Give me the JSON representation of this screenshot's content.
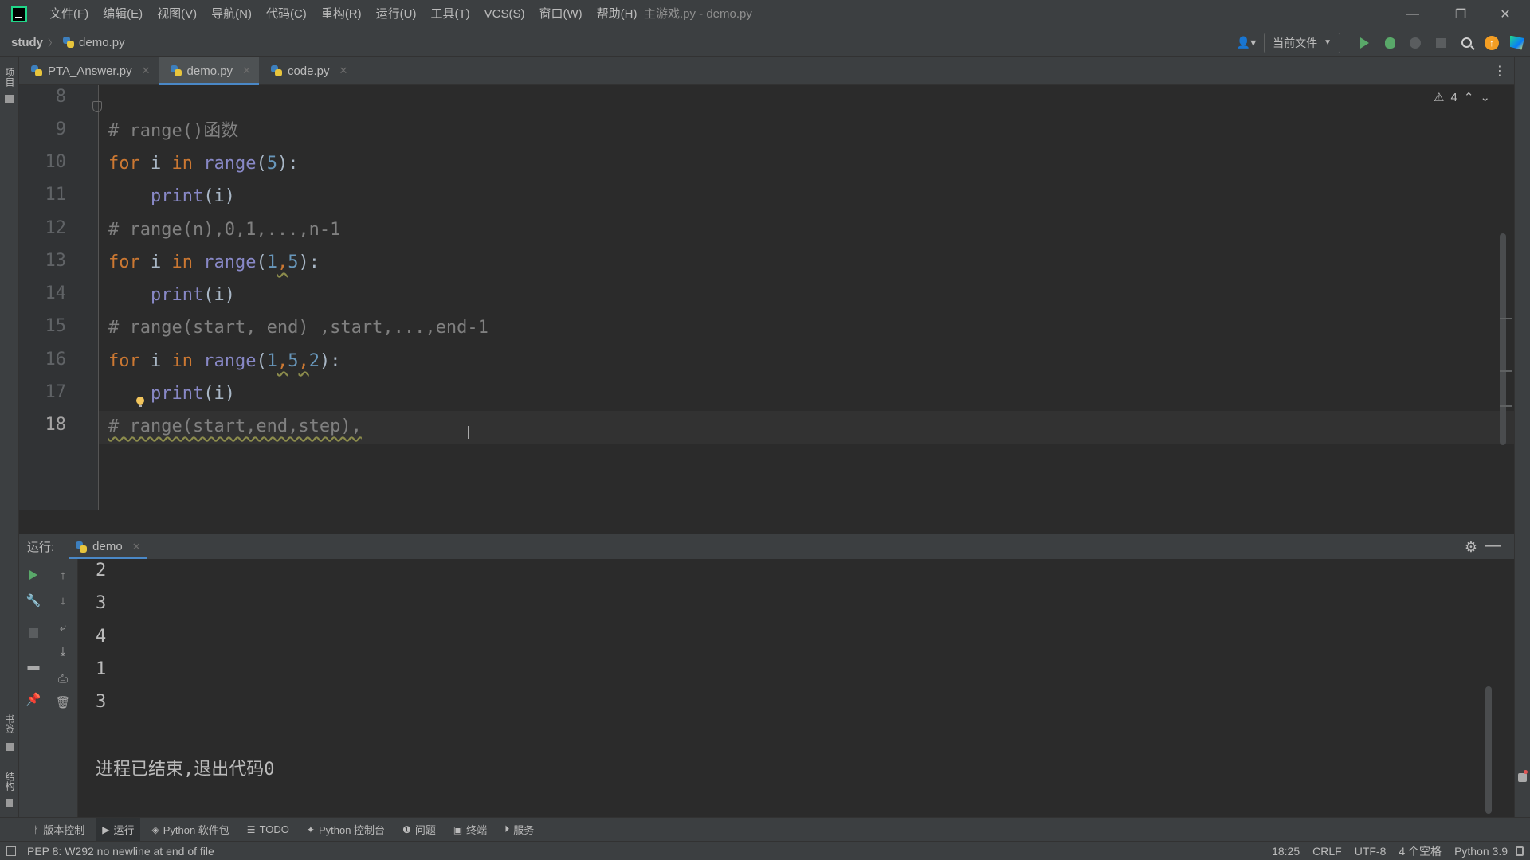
{
  "menu": [
    "文件(F)",
    "编辑(E)",
    "视图(V)",
    "导航(N)",
    "代码(C)",
    "重构(R)",
    "运行(U)",
    "工具(T)",
    "VCS(S)",
    "窗口(W)",
    "帮助(H)"
  ],
  "window_title": "主游戏.py - demo.py",
  "breadcrumb": {
    "project": "study",
    "file": "demo.py"
  },
  "run_config": "当前文件",
  "tabs": [
    {
      "label": "PTA_Answer.py",
      "active": false
    },
    {
      "label": "demo.py",
      "active": true
    },
    {
      "label": "code.py",
      "active": false
    }
  ],
  "left_strip": {
    "project": "项目",
    "bookmarks": "书签",
    "structure": "结构"
  },
  "editor": {
    "warning_count": "4",
    "line_numbers": [
      "8",
      "9",
      "10",
      "11",
      "12",
      "13",
      "14",
      "15",
      "16",
      "17",
      "18"
    ],
    "current_line": "18"
  },
  "run_panel": {
    "label": "运行:",
    "tab": "demo",
    "output": [
      "2",
      "3",
      "4",
      "1",
      "3"
    ],
    "exit_message": "进程已结束,退出代码0"
  },
  "bottom_tools": [
    {
      "label": "版本控制",
      "icon": "branch-icon"
    },
    {
      "label": "运行",
      "icon": "play-icon"
    },
    {
      "label": "Python 软件包",
      "icon": "layers-icon"
    },
    {
      "label": "TODO",
      "icon": "list-icon"
    },
    {
      "label": "Python 控制台",
      "icon": "python-icon"
    },
    {
      "label": "问题",
      "icon": "info-icon"
    },
    {
      "label": "终端",
      "icon": "terminal-icon"
    },
    {
      "label": "服务",
      "icon": "services-icon"
    }
  ],
  "status": {
    "message": "PEP 8: W292 no newline at end of file",
    "position": "18:25",
    "line_sep": "CRLF",
    "encoding": "UTF-8",
    "indent": "4 个空格",
    "interpreter": "Python 3.9"
  },
  "colors": {
    "keyword": "#cc7832",
    "builtin": "#8888c6",
    "number": "#6897bb",
    "comment": "#808080",
    "accent": "#4a88c7"
  }
}
